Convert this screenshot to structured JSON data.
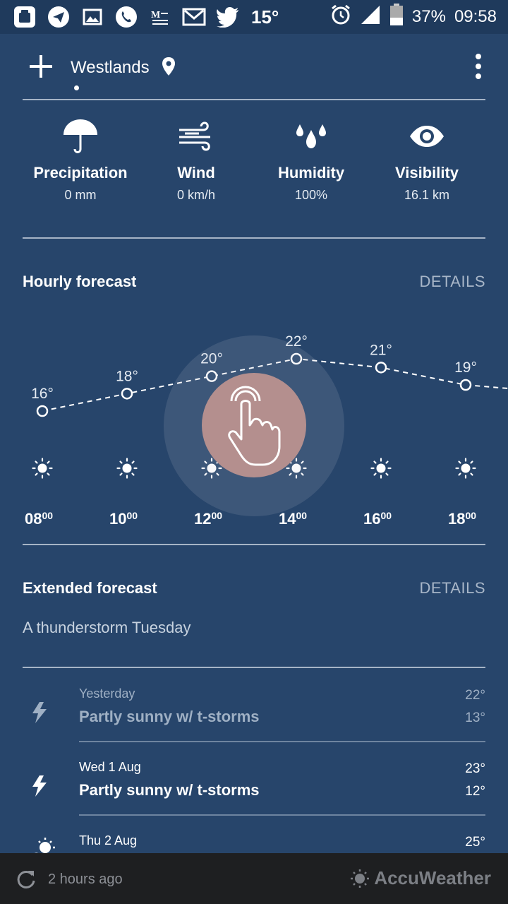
{
  "status_bar": {
    "temperature": "15°",
    "battery": "37%",
    "time": "09:58",
    "icons": [
      "calendar-icon",
      "telegram-icon",
      "gallery-icon",
      "phone-icon",
      "news-icon",
      "gmail-icon",
      "twitter-icon"
    ],
    "right_icons": [
      "alarm-icon",
      "signal-icon",
      "battery-icon"
    ]
  },
  "header": {
    "location": "Westlands",
    "icons": [
      "add-icon",
      "location-pin-icon",
      "more-vert-icon"
    ]
  },
  "conditions": [
    {
      "icon": "umbrella-icon",
      "label": "Precipitation",
      "value": "0 mm"
    },
    {
      "icon": "wind-icon",
      "label": "Wind",
      "value": "0 km/h"
    },
    {
      "icon": "humidity-drops-icon",
      "label": "Humidity",
      "value": "100%"
    },
    {
      "icon": "eye-icon",
      "label": "Visibility",
      "value": "16.1 km"
    }
  ],
  "hourly": {
    "title": "Hourly forecast",
    "details_label": "DETAILS",
    "chart_data": {
      "type": "line",
      "x": [
        "08:00",
        "10:00",
        "12:00",
        "14:00",
        "16:00",
        "18:00"
      ],
      "values": [
        16,
        18,
        20,
        22,
        21,
        19
      ],
      "labels": [
        "16°",
        "18°",
        "20°",
        "22°",
        "21°",
        "19°"
      ],
      "conditions": [
        "sunny",
        "sunny",
        "sunny",
        "sunny",
        "sunny",
        "sunny"
      ]
    },
    "times": [
      {
        "hour": "08",
        "min": "00"
      },
      {
        "hour": "10",
        "min": "00"
      },
      {
        "hour": "12",
        "min": "00"
      },
      {
        "hour": "14",
        "min": "00"
      },
      {
        "hour": "16",
        "min": "00"
      },
      {
        "hour": "18",
        "min": "00"
      }
    ]
  },
  "extended": {
    "title": "Extended forecast",
    "details_label": "DETAILS",
    "summary": "A thunderstorm Tuesday",
    "days": [
      {
        "label": "Yesterday",
        "desc": "Partly sunny w/ t-storms",
        "hi": "22°",
        "lo": "13°",
        "icon": "lightning-icon",
        "muted": true
      },
      {
        "label": "Wed 1 Aug",
        "desc": "Partly sunny w/ t-storms",
        "hi": "23°",
        "lo": "12°",
        "icon": "lightning-icon",
        "muted": false
      },
      {
        "label": "Thu 2 Aug",
        "desc": "",
        "hi": "25°",
        "lo": "",
        "icon": "partly-sunny-icon",
        "muted": false
      }
    ]
  },
  "footer": {
    "updated": "2 hours ago",
    "brand": "AccuWeather",
    "icons": [
      "refresh-icon",
      "accuweather-logo-icon"
    ]
  },
  "colors": {
    "background": "#27456b",
    "status_bar": "#1f3a5c",
    "footer": "#1e1f21",
    "touch_indicator": "#b48f8e"
  }
}
